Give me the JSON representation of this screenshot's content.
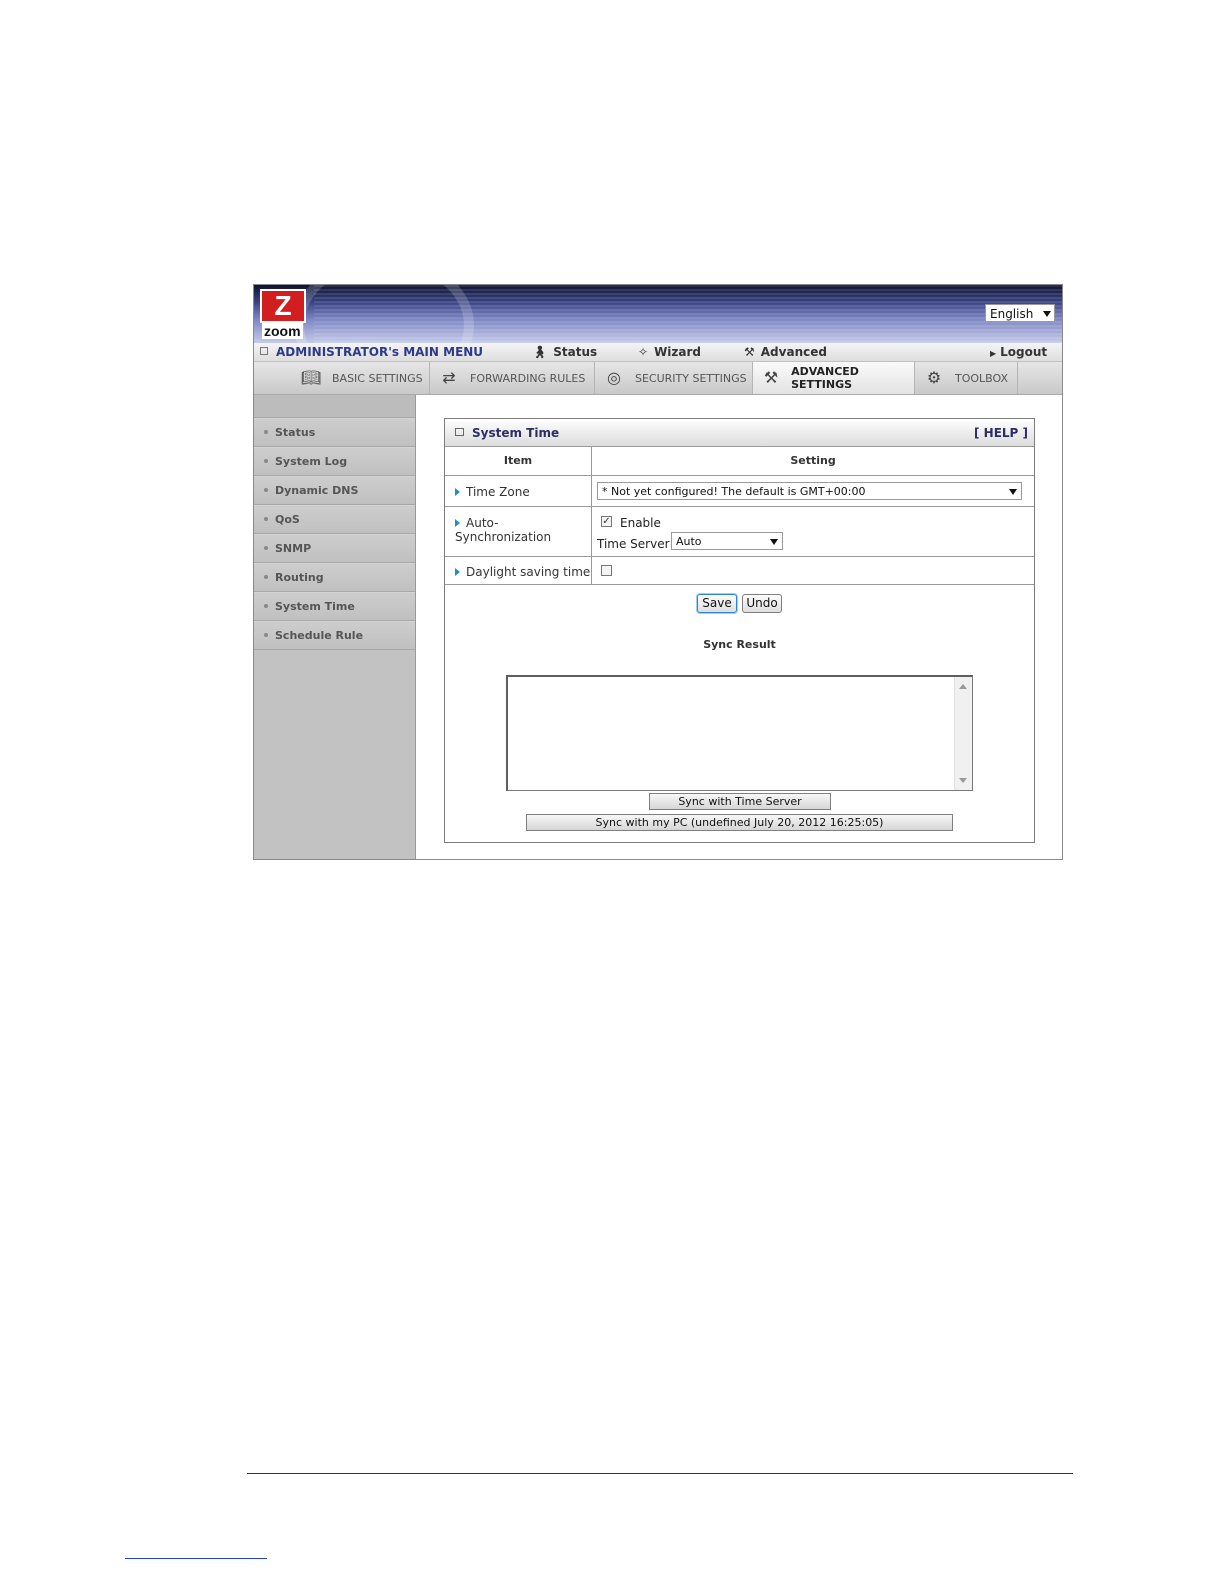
{
  "header": {
    "logo_letter": "Z",
    "logo_word": "zoom",
    "language": "English"
  },
  "menubar": {
    "title": "ADMINISTRATOR's MAIN MENU",
    "items": [
      {
        "label": "Status",
        "icon": "person-icon"
      },
      {
        "label": "Wizard",
        "icon": "wand-icon"
      },
      {
        "label": "Advanced",
        "icon": "tools-icon"
      }
    ],
    "logout": "Logout"
  },
  "tabs": [
    {
      "label": "BASIC SETTINGS",
      "icon": "book-icon"
    },
    {
      "label": "FORWARDING RULES",
      "icon": "arrows-icon"
    },
    {
      "label": "SECURITY SETTINGS",
      "icon": "lock-icon"
    },
    {
      "label": "ADVANCED SETTINGS",
      "icon": "tools-icon",
      "active": true
    },
    {
      "label": "TOOLBOX",
      "icon": "toolbox-icon"
    }
  ],
  "sidebar": {
    "items": [
      {
        "label": "Status"
      },
      {
        "label": "System Log"
      },
      {
        "label": "Dynamic DNS"
      },
      {
        "label": "QoS"
      },
      {
        "label": "SNMP"
      },
      {
        "label": "Routing"
      },
      {
        "label": "System Time"
      },
      {
        "label": "Schedule Rule"
      }
    ]
  },
  "panel": {
    "title": "System Time",
    "help": "[ HELP ]",
    "col_item": "Item",
    "col_setting": "Setting",
    "time_zone_label": "Time Zone",
    "time_zone_value": "* Not yet configured! The default is GMT+00:00",
    "auto_sync_label": "Auto-Synchronization",
    "enable_label": "Enable",
    "enable_checked": true,
    "time_server_label": "Time Server :",
    "time_server_value": "Auto",
    "dst_label": "Daylight saving time",
    "dst_checked": false,
    "save_label": "Save",
    "undo_label": "Undo",
    "sync_result_label": "Sync Result",
    "sync_result_text": "",
    "sync_server_button": "Sync with Time Server",
    "sync_pc_button": "Sync with my PC (undefined July 20, 2012 16:25:05)"
  },
  "colors": {
    "accent_blue": "#2c3a8c",
    "arrow_blue": "#1e8fc6",
    "logo_red": "#d21e1e",
    "sidebar_gray": "#c2c2c2"
  }
}
